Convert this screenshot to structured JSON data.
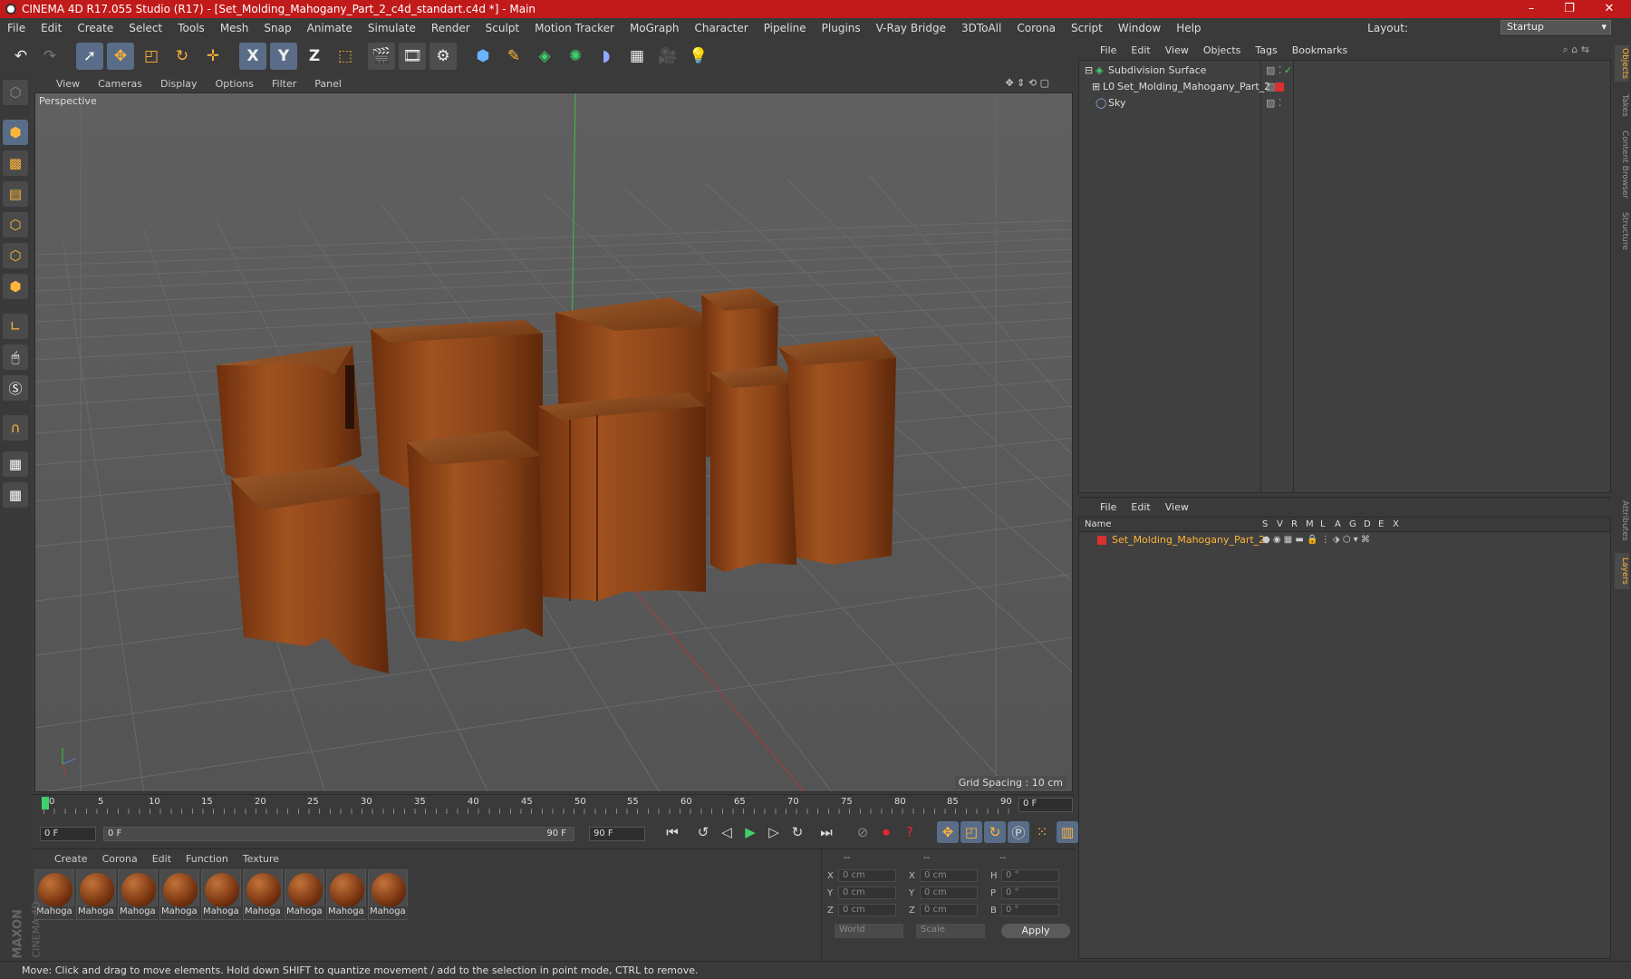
{
  "window": {
    "title": "CINEMA 4D R17.055 Studio (R17) - [Set_Molding_Mahogany_Part_2_c4d_standart.c4d *] - Main",
    "controls": [
      "–",
      "❐",
      "✕"
    ]
  },
  "menubar": [
    "File",
    "Edit",
    "Create",
    "Select",
    "Tools",
    "Mesh",
    "Snap",
    "Animate",
    "Simulate",
    "Render",
    "Sculpt",
    "Motion Tracker",
    "MoGraph",
    "Character",
    "Pipeline",
    "Plugins",
    "V-Ray Bridge",
    "3DToAll",
    "Corona",
    "Script",
    "Window",
    "Help"
  ],
  "layout": {
    "label": "Layout:",
    "value": "Startup"
  },
  "toolbar": {
    "axis_x": "X",
    "axis_y": "Y",
    "axis_z": "Z"
  },
  "viewport": {
    "menu": [
      "View",
      "Cameras",
      "Display",
      "Options",
      "Filter",
      "Panel"
    ],
    "camera_label": "Perspective",
    "grid_spacing": "Grid Spacing : 10 cm"
  },
  "timeline": {
    "ticks": [
      "0",
      "5",
      "10",
      "15",
      "20",
      "25",
      "30",
      "35",
      "40",
      "45",
      "50",
      "55",
      "60",
      "65",
      "70",
      "75",
      "80",
      "85",
      "90"
    ],
    "current_frame": "0 F",
    "start_field": "0 F",
    "range_start": "0 F",
    "range_end": "90 F",
    "end_field": "90 F"
  },
  "materials": {
    "menu": [
      "Create",
      "Corona",
      "Edit",
      "Function",
      "Texture"
    ],
    "items": [
      "Mahoga",
      "Mahoga",
      "Mahoga",
      "Mahoga",
      "Mahoga",
      "Mahoga",
      "Mahoga",
      "Mahoga",
      "Mahoga"
    ]
  },
  "coordinates": {
    "header": [
      "--",
      "--",
      "--"
    ],
    "rows": [
      {
        "a": "X",
        "av": "0 cm",
        "b": "X",
        "bv": "0 cm",
        "c": "H",
        "cv": "0 °"
      },
      {
        "a": "Y",
        "av": "0 cm",
        "b": "Y",
        "bv": "0 cm",
        "c": "P",
        "cv": "0 °"
      },
      {
        "a": "Z",
        "av": "0 cm",
        "b": "Z",
        "bv": "0 cm",
        "c": "B",
        "cv": "0 °"
      }
    ],
    "mode1": "World",
    "mode2": "Scale",
    "apply": "Apply"
  },
  "object_manager": {
    "menu": [
      "File",
      "Edit",
      "View",
      "Objects",
      "Tags",
      "Bookmarks"
    ],
    "objects": [
      "Subdivision Surface",
      "Set_Molding_Mahogany_Part_2",
      "Sky"
    ]
  },
  "layer_manager": {
    "menu": [
      "File",
      "Edit",
      "View"
    ],
    "columns": [
      "Name",
      "S",
      "V",
      "R",
      "M",
      "L",
      "A",
      "G",
      "D",
      "E",
      "X"
    ],
    "layer": "Set_Molding_Mahogany_Part_2"
  },
  "side_tabs": [
    "Objects",
    "Takes",
    "Content Browser",
    "Structure",
    "Attributes",
    "Layers"
  ],
  "logo": {
    "line1": "MAXON",
    "line2": "CINEMA 4D"
  },
  "status": "Move: Click and drag to move elements. Hold down SHIFT to quantize movement / add to the selection in point mode, CTRL to remove.",
  "colors": {
    "titlebar": "#c01a1a",
    "accent": "#ffb53a",
    "wood": "#8a4318"
  }
}
